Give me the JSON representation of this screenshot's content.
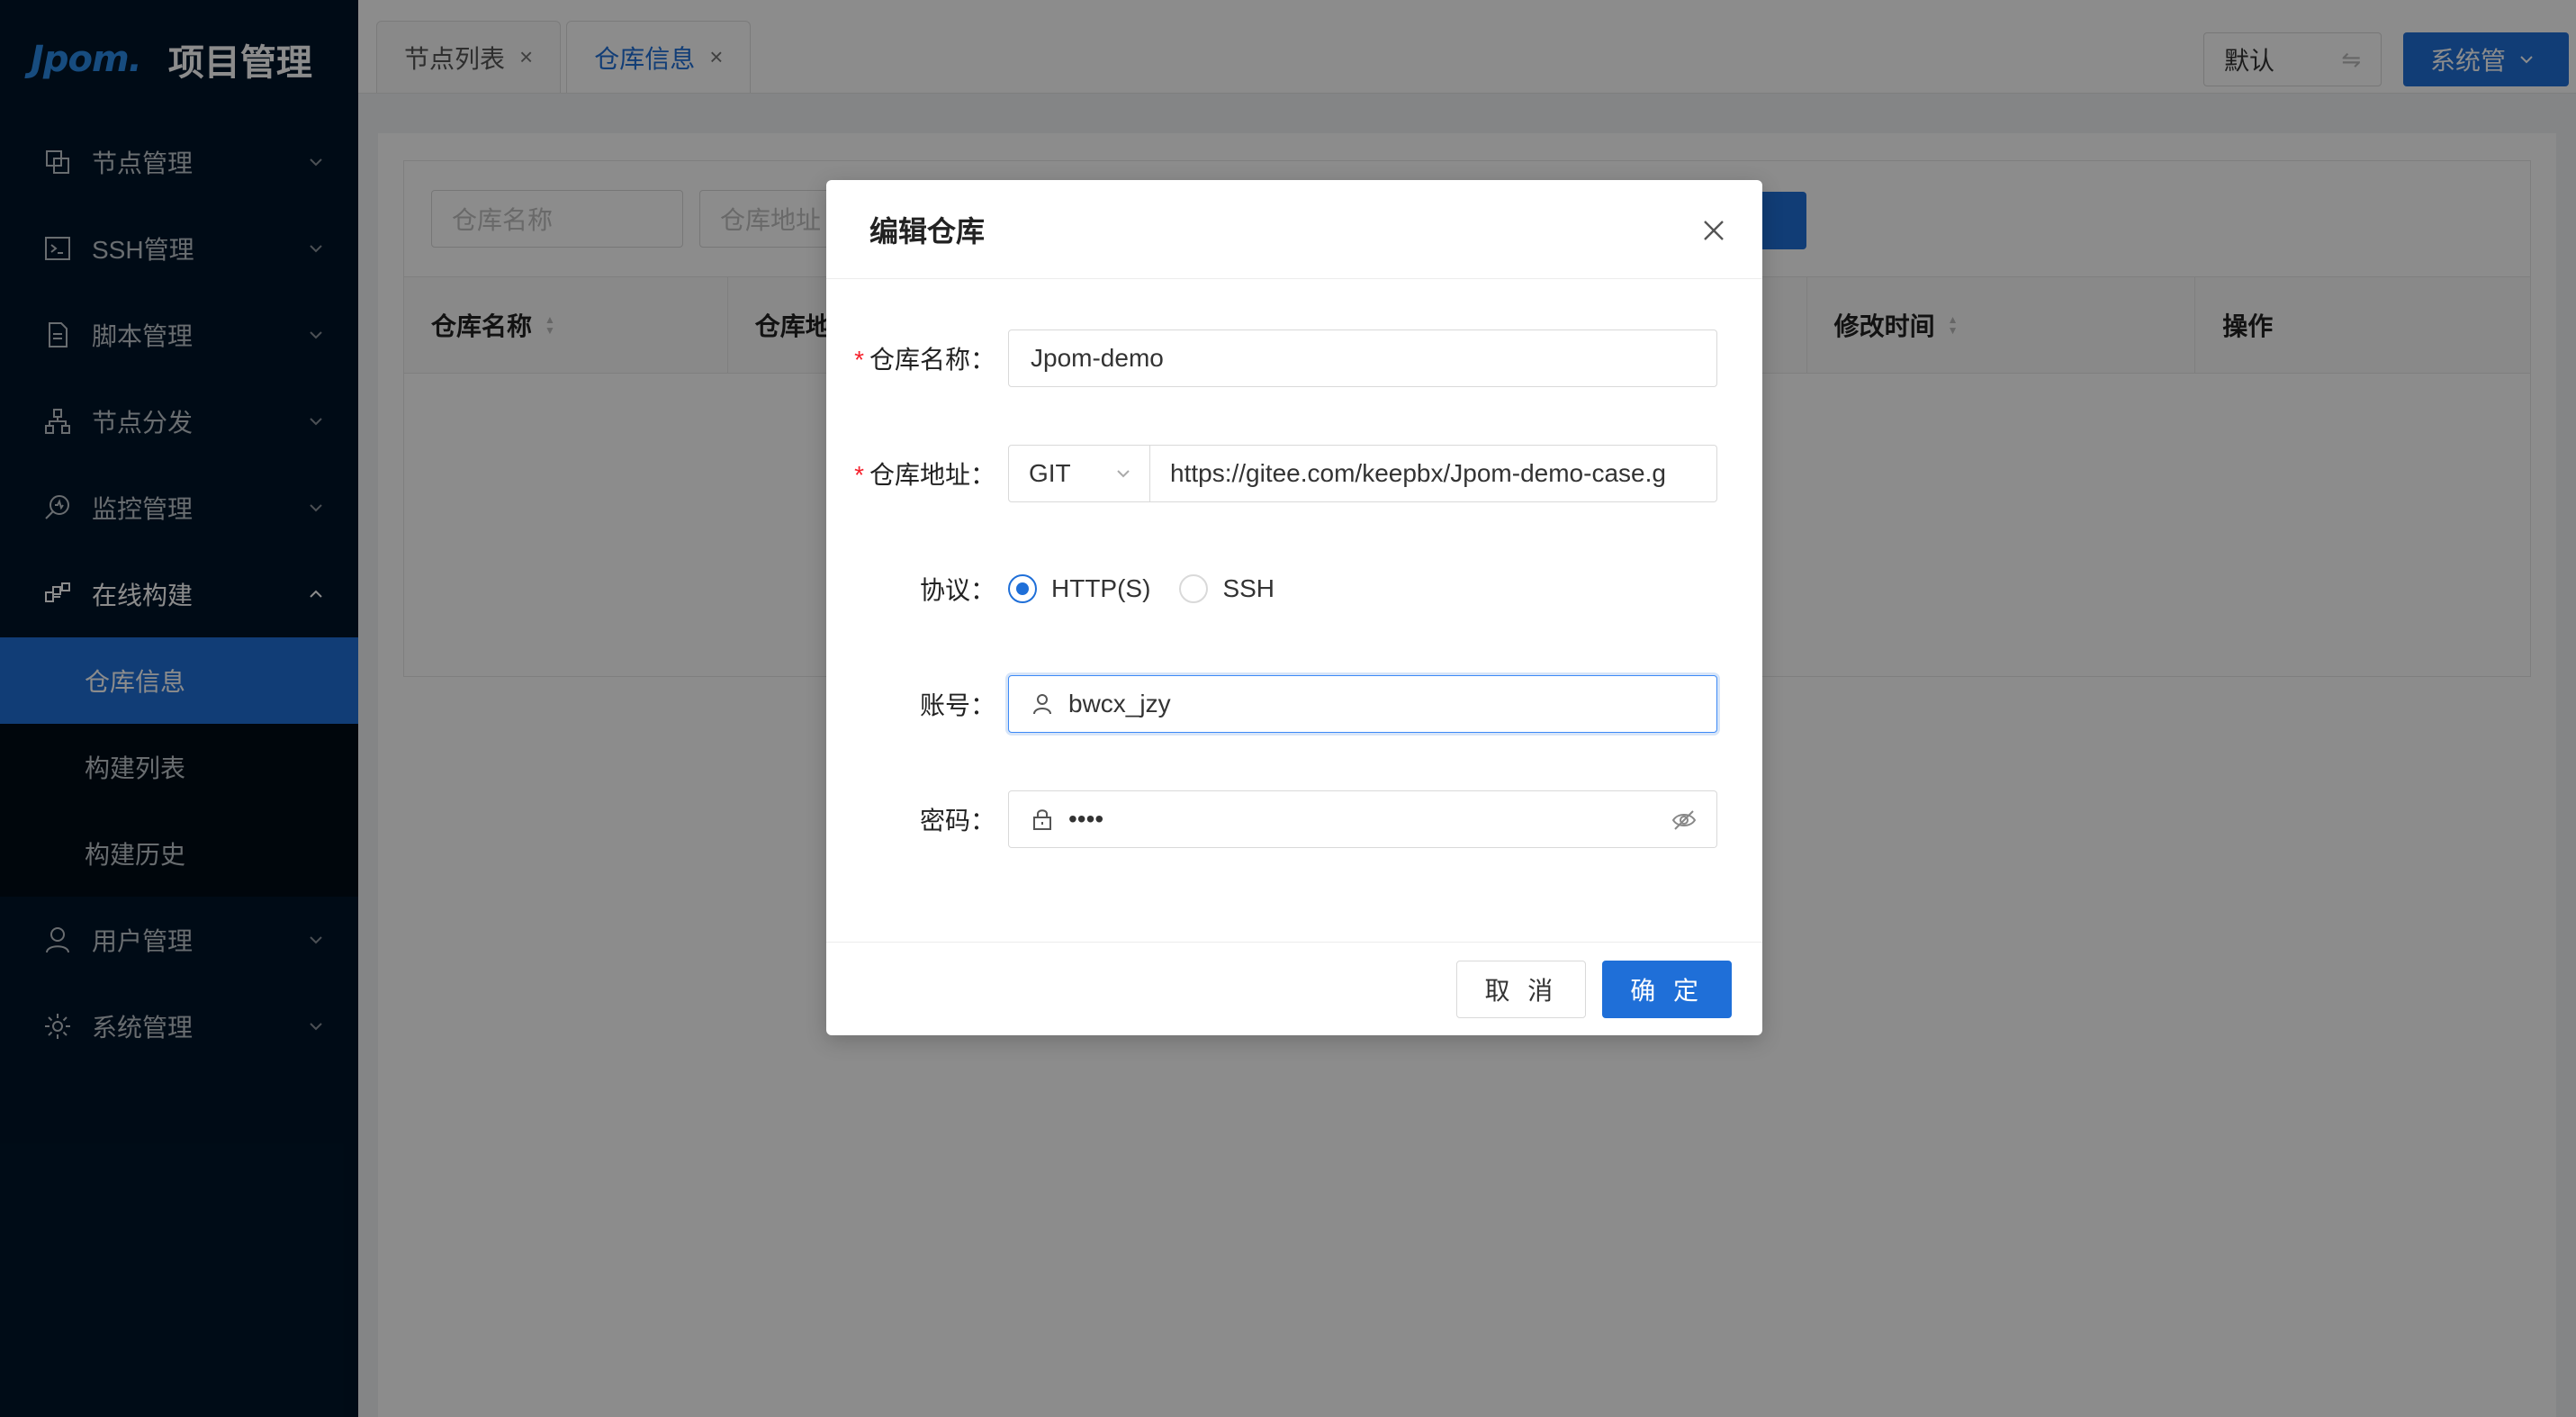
{
  "brand": {
    "logo": "Jpom.",
    "title": "项目管理"
  },
  "sidebar": {
    "items": [
      {
        "label": "节点管理",
        "icon": "nodes-icon"
      },
      {
        "label": "SSH管理",
        "icon": "terminal-icon"
      },
      {
        "label": "脚本管理",
        "icon": "file-icon"
      },
      {
        "label": "节点分发",
        "icon": "cluster-icon"
      },
      {
        "label": "监控管理",
        "icon": "monitor-icon"
      },
      {
        "label": "在线构建",
        "icon": "build-icon",
        "open": true
      },
      {
        "label": "用户管理",
        "icon": "user-icon"
      },
      {
        "label": "系统管理",
        "icon": "gear-icon"
      }
    ],
    "submenu": [
      {
        "label": "仓库信息",
        "active": true
      },
      {
        "label": "构建列表"
      },
      {
        "label": "构建历史"
      }
    ]
  },
  "tabs": [
    {
      "label": "节点列表",
      "close": "×"
    },
    {
      "label": "仓库信息",
      "close": "×",
      "active": true
    }
  ],
  "header": {
    "workspace": "默认",
    "system_btn": "系统管"
  },
  "filters": {
    "name_placeholder": "仓库名称",
    "url_placeholder": "仓库地址"
  },
  "table": {
    "columns": [
      "仓库名称",
      "仓库地址",
      "修改时间",
      "操作"
    ]
  },
  "modal": {
    "title": "编辑仓库",
    "name_label": "仓库名称",
    "name_value": "Jpom-demo",
    "url_label": "仓库地址",
    "repo_type": "GIT",
    "url_value": "https://gitee.com/keepbx/Jpom-demo-case.g",
    "protocol_label": "协议",
    "protocols": [
      "HTTP(S)",
      "SSH"
    ],
    "account_label": "账号",
    "account_value": "bwcx_jzy",
    "password_label": "密码",
    "password_value": "••••",
    "cancel": "取 消",
    "ok": "确 定"
  },
  "colors": {
    "primary": "#1f6fd8",
    "sidebar_bg": "#001529",
    "required": "#f5222d"
  }
}
